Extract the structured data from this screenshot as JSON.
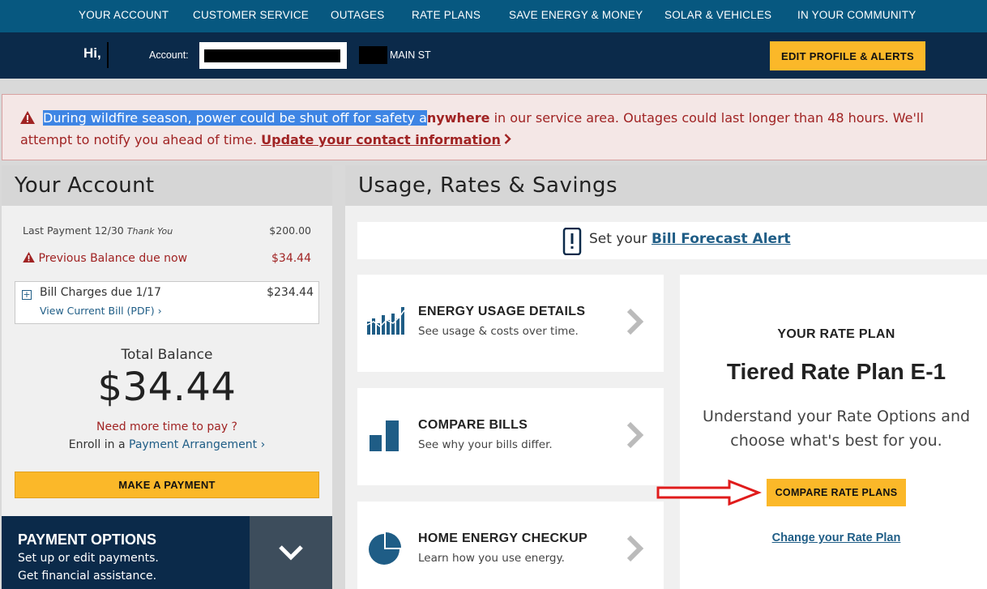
{
  "topnav": {
    "items": [
      "YOUR ACCOUNT",
      "CUSTOMER SERVICE",
      "OUTAGES",
      "RATE PLANS",
      "SAVE ENERGY & MONEY",
      "SOLAR & VEHICLES",
      "IN YOUR COMMUNITY"
    ]
  },
  "account_bar": {
    "greeting": "Hi,",
    "account_label": "Account:",
    "address": "MAIN ST",
    "edit_button": "EDIT PROFILE & ALERTS"
  },
  "alert": {
    "highlighted": "During wildfire season, power could be shut off for safety a",
    "bold_part": "nywhere",
    "text": " in our service area. Outages could last longer than 48 hours. We'll attempt to notify you ahead of time. ",
    "link": "Update your contact information",
    "icon": "warning-triangle-icon"
  },
  "your_account": {
    "title": "Your Account",
    "last_payment_label": "Last Payment 12/30",
    "last_payment_note": "Thank You",
    "last_payment_amount": "$200.00",
    "previous_balance_label": "Previous Balance due now",
    "previous_balance_amount": "$34.44",
    "bill_charges_label": "Bill Charges due 1/17",
    "bill_charges_amount": "$234.44",
    "view_bill_link": "View Current Bill (PDF)",
    "total_label": "Total Balance",
    "total_value": "$34.44",
    "need_more_time": "Need more time to pay ?",
    "enroll_prefix": "Enroll in a ",
    "enroll_link": "Payment Arrangement",
    "make_payment_button": "MAKE A PAYMENT",
    "payment_options_title": "PAYMENT OPTIONS",
    "payment_options_line1": "Set up or edit payments.",
    "payment_options_line2": "Get financial assistance."
  },
  "usage": {
    "title": "Usage, Rates & Savings",
    "forecast_prefix": "Set your ",
    "forecast_link": "Bill Forecast Alert",
    "tiles": [
      {
        "title": "ENERGY USAGE DETAILS",
        "subtitle": "See usage & costs over time."
      },
      {
        "title": "COMPARE BILLS",
        "subtitle": "See why your bills differ."
      },
      {
        "title": "HOME ENERGY CHECKUP",
        "subtitle": "Learn how you use energy."
      }
    ]
  },
  "rate_plan": {
    "heading": "YOUR RATE PLAN",
    "plan_name": "Tiered Rate Plan E-1",
    "description": "Understand your Rate Options and choose what's best for you.",
    "compare_button": "COMPARE RATE PLANS",
    "change_link": "Change your Rate Plan"
  },
  "colors": {
    "nav_blue": "#075880",
    "dark_navy": "#0b2a4a",
    "accent_yellow": "#fbb829",
    "alert_red": "#a02323",
    "link_blue": "#1f5d86"
  }
}
